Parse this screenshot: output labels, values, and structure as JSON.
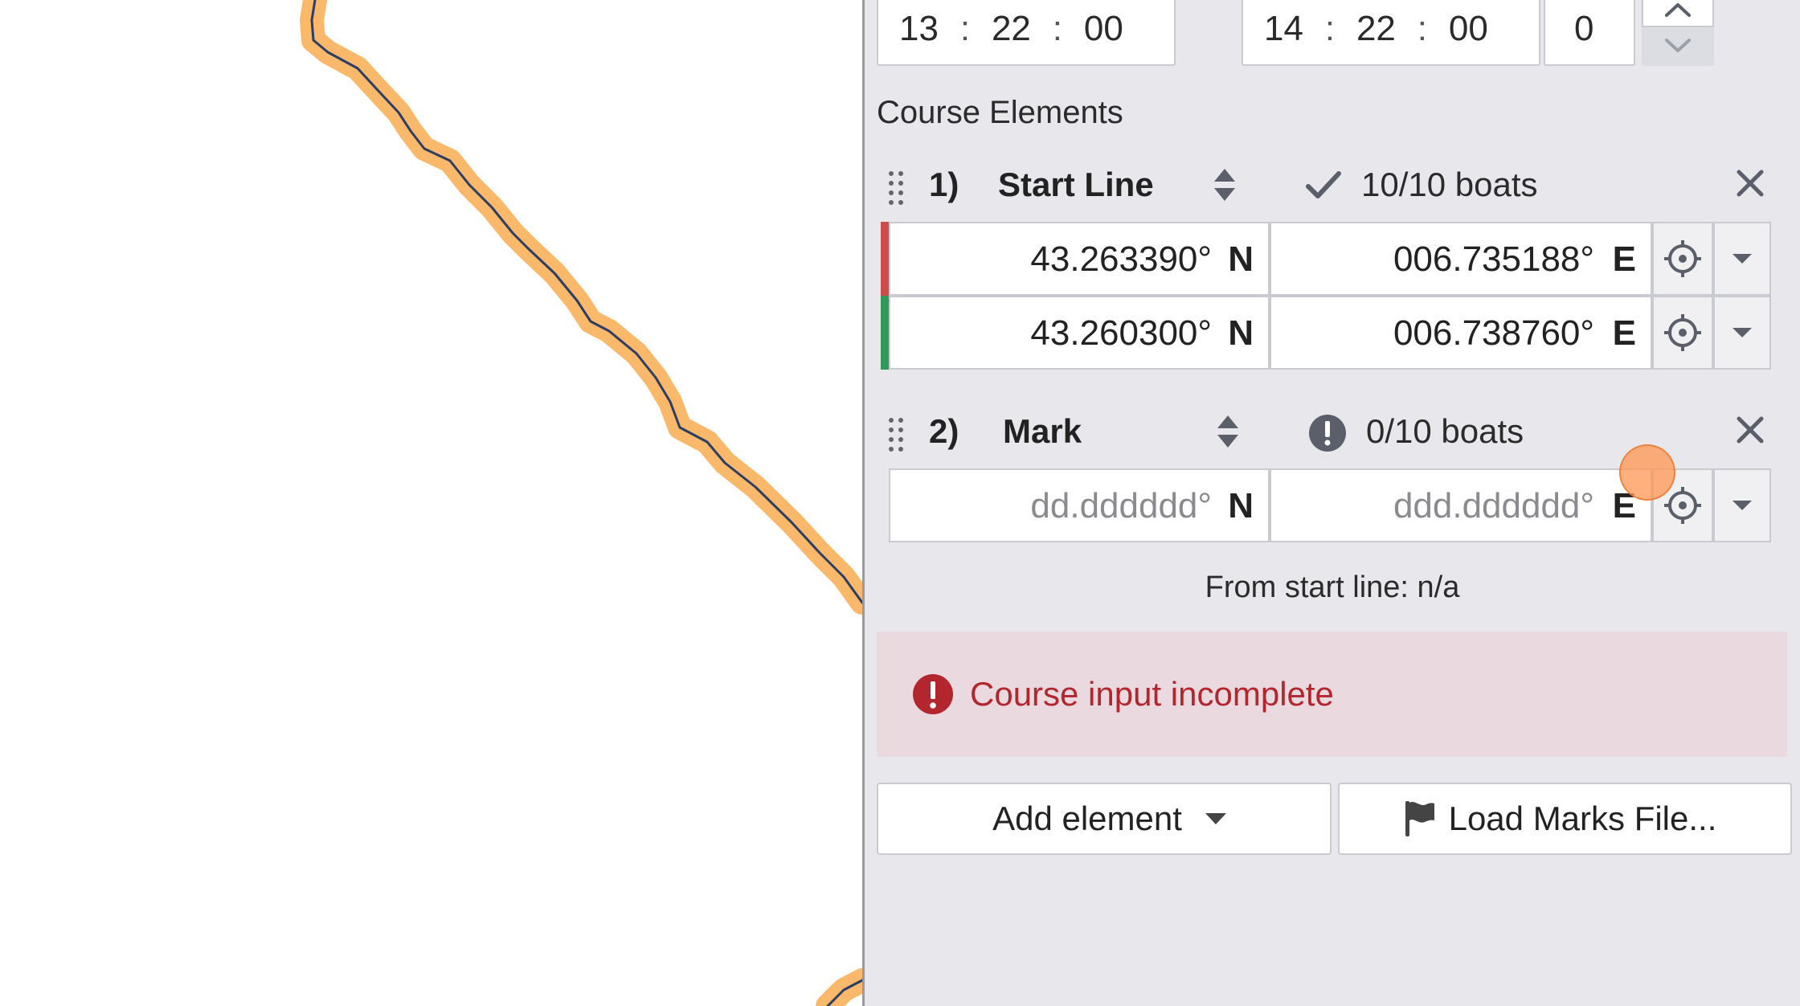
{
  "window": {
    "start_time": {
      "hh": "13",
      "mm": "22",
      "ss": "00"
    },
    "end_time": {
      "hh": "14",
      "mm": "22",
      "ss": "00"
    },
    "offset_value": "0",
    "time_separator": ":"
  },
  "course": {
    "section_title": "Course Elements",
    "elements": [
      {
        "number": "1)",
        "name": "Start Line",
        "boats": "10/10 boats",
        "status": "complete",
        "points": [
          {
            "lat": "43.263390°",
            "lat_hemi": "N",
            "lon": "006.735188°",
            "lon_hemi": "E",
            "side_color": "#d04a4a"
          },
          {
            "lat": "43.260300°",
            "lat_hemi": "N",
            "lon": "006.738760°",
            "lon_hemi": "E",
            "side_color": "#2e9a55"
          }
        ]
      },
      {
        "number": "2)",
        "name": "Mark",
        "boats": "0/10 boats",
        "status": "incomplete",
        "points": [
          {
            "lat_placeholder": "dd.dddddd°",
            "lat_hemi": "N",
            "lon_placeholder": "ddd.dddddd°",
            "lon_hemi": "E"
          }
        ]
      }
    ],
    "from_start_line": "From start line: n/a"
  },
  "alert": {
    "message": "Course input incomplete",
    "color": "#b3262e"
  },
  "actions": {
    "add_element": "Add element",
    "load_marks": "Load Marks File..."
  },
  "colors": {
    "panel_bg": "#e8e8ec",
    "track_halo": "#f9b86a",
    "track_line": "#2c3e63"
  }
}
